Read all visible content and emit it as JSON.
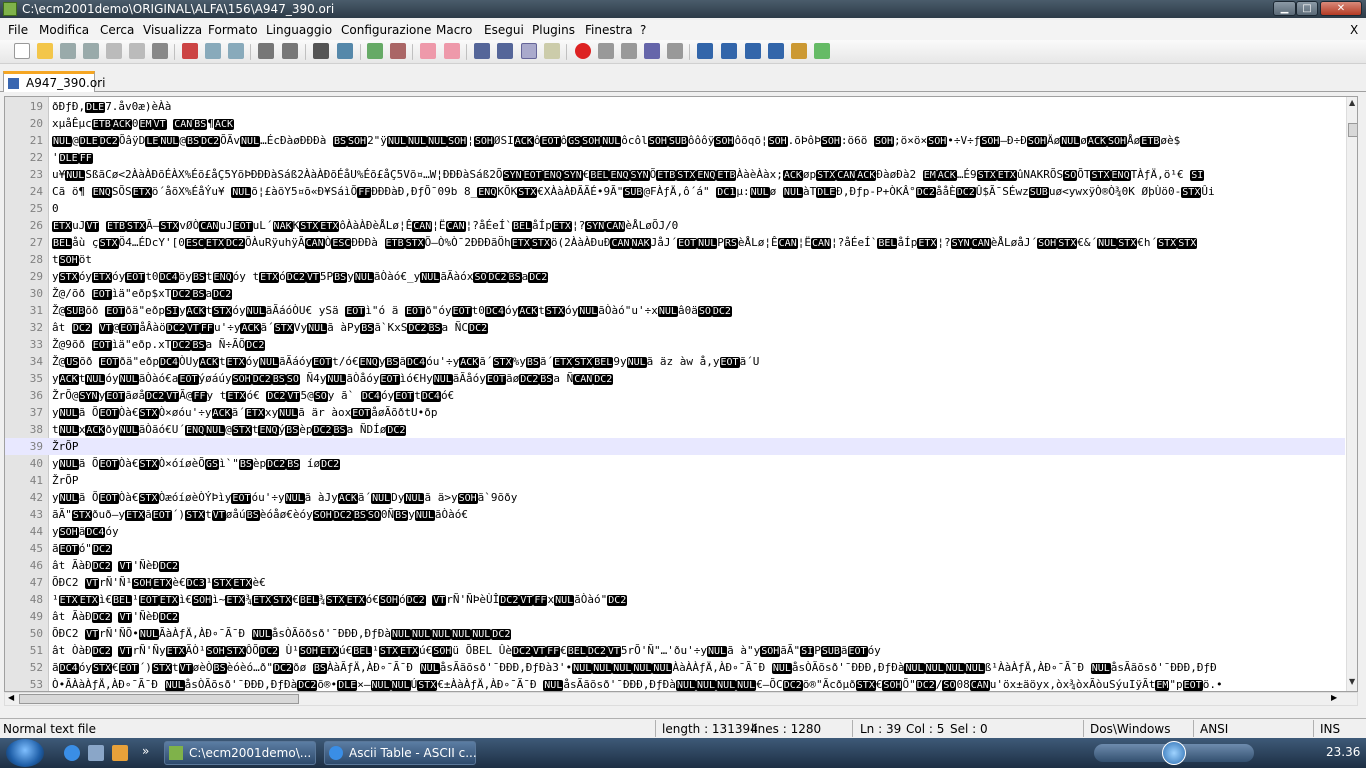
{
  "window": {
    "title": "C:\\ecm2001demo\\ORIGINAL\\ALFA\\156\\A947_390.ori",
    "minimize_icon": "minimize-icon",
    "maximize_icon": "maximize-icon",
    "close_icon": "close-icon"
  },
  "menu": {
    "items": [
      "File",
      "Modifica",
      "Cerca",
      "Visualizza",
      "Formato",
      "Linguaggio",
      "Configurazione",
      "Macro",
      "Esegui",
      "Plugins",
      "Finestra",
      "?"
    ],
    "close_label": "X"
  },
  "toolbar": {
    "buttons": [
      "new-icon",
      "open-icon",
      "save-icon",
      "save-all-icon",
      "close-icon",
      "close-all-icon",
      "print-icon",
      "cut-icon",
      "copy-icon",
      "paste-icon",
      "undo-icon",
      "redo-icon",
      "find-icon",
      "replace-icon",
      "zoom-in-icon",
      "zoom-out-icon",
      "sync-v-icon",
      "sync-h-icon",
      "word-wrap-icon",
      "show-all-chars-icon",
      "indent-guide-icon",
      "doc-map-icon",
      "record-macro-icon",
      "stop-record-icon",
      "play-macro-icon",
      "run-macro-multiple-icon",
      "save-macro-icon",
      "first-icon",
      "up-icon",
      "down-icon",
      "last-icon",
      "launch-icon",
      "spellcheck-icon"
    ]
  },
  "tabs": [
    {
      "label": "A947_390.ori",
      "icon": "document-icon"
    }
  ],
  "editor": {
    "current_line": 39,
    "lines": [
      {
        "n": "19",
        "t": "ðÐƒÐ,[DLE]7.åv0æ)èÀà"
      },
      {
        "n": "20",
        "t": "xµåÊµc[ETB][ACK]0[EM][VT] [CAN][BS]¶[ACK]"
      },
      {
        "n": "21",
        "t": "[NUL]@[DLE][DC2]ÕâÿD[LE][NUL]@[BS][DC2]ÕÃv[NUL]…ÉcÐàøÐÐÐà [BS][SOH]2\"ÿ[NUL][NUL][NUL][SOH]¦[SOH]ØSI[ACK]ô[EOT]ô[GS][SOH][NUL]ôcôl[SOH][SUB]ôôôÿ[SOH]ôõqõ¦[SOH].õÞôÞ[SOH]:ö6ö [SOH];ö×ö×[SOH]•÷V÷ƒ[SOH]–Ð÷Ð[SOH]Äø[NUL]ø[ACK][SOH]Åø[ETB]øè$"
      },
      {
        "n": "22",
        "t": "'[DLE][FF]"
      },
      {
        "n": "23",
        "t": "u¥[NUL]SßãCø<2ÀàÀÐõÉÀX%Éõ£åÇ5YõÞÐÐÐàSáß2ÀàÀÐõÉåU%Éõ£åÇ5Võ¤…W¦ÐÐÐàSáß2Õ[SYN][EOT][ENQ][SYN]€[BEL][ENQ][SYN]Õ[ETB][STX][ENQ][ETB]ÀàèÀàx;[ACK]øp[STX][CAN][ACK]ÐàøÐà2 [EM][ACK]…É9[STX][ETX]ûNAKRÕS[SO]ÕT[STX][ENQ]TÀƒÄ,ö¹€ [SI]"
      },
      {
        "n": "24",
        "t": "Cã ö¶ [ENQ]SÕS[ETX]ö´åõX%ÉåÝu¥ [NUL]õ¦£àõY5¤õ«Ð¥SáìÕ[FF]ÐÐÐàÐ,ÐƒÕ¯09b 8_[ENQ]KÕK[STX]€XÀàÀÐÃÃÉ•9Ã\"[SUB]@FÀƒÄ,ô´á\" [DC1]µ:[NUL]ø [NUL]àT[DLE]Ð,Ðƒp-P+ÒKÂ°[DC2]ååÈ[DC2]Û$Ã¯SÉwz[SUB]uø<ywxÿÒ®Ò¾0K  ØþÙö0-[STX]Ûi"
      },
      {
        "n": "25",
        "t": "0"
      },
      {
        "n": "26",
        "t": "[ETX]uJ[VT] [ETB][STX]Ã—[STX]vØÒ[CAN]uJ[EOT]uL´[NAK]K[STX][ETX]ôÀàÀÐèÅLø¦Ê[CAN]¦Ë[CAN]¦?åÉeÍ`[BEL]åÍp[ETX]¦?[SYN][CAN]èÅLøÕJ/0"
      },
      {
        "n": "27",
        "t": "[BEL]åù ç[STX]Ö4…ÉDcY'[0[ESC][ETX][DC2]ÕÀuRÿuhÿÃ[CAN]Ò[ESC]ÐÐÐà [ETB][STX]Õ—Ò%Ò¯2ÐÐÐãÖh[ETX][STX]ö(2ÀàÀÐuÐ[CAN][NAK]JåJ´[EOT][NUL]P[RS]èÅLø¦Ê[CAN]¦Ë[CAN]¦?åÉeÍ`[BEL]åÍp[ETX]¦?[SYN][CAN]èÅLøåJ´[SOH][STX]€&´[NUL][STX]€h´[STX][STX]"
      },
      {
        "n": "28",
        "t": "t[SOH]öt"
      },
      {
        "n": "29",
        "t": "y[STX]óy[ETX]óy[EOT]t0[DC4]öy[BS]t[ENQ]óy t[ETX]ó[DC2][VT]5P[BS]y[NUL]ãÒàó€_y[NUL]ãÃàóx[SO][DC2][BS]a[DC2]"
      },
      {
        "n": "30",
        "t": "Ž@/õð [EOT]ìä\"eðp$xT[DC2][BS]a[DC2]"
      },
      {
        "n": "31",
        "t": "Ž@[SUB]õð [EOT]ðä\"eðp[SI]y[ACK]t[STX]óy[NUL]ãÃáóÒU€ ySä [EOT]ì\"ó  ä [EOT]ð\"óy[EOT]t0[DC4]óy[ACK]t[STX]óy[NUL]ãÒàó\"u'÷x[NUL]â0ä[SO][DC2]"
      },
      {
        "n": "32",
        "t": "ât [DC2] [VT]@[EOT]åÂàö[DC2][VT][FF]u'÷y[ACK]ã´[STX]Vy[NUL]ã àPy[BS]ã`KxS[DC2][BS]a ÑC[DC2]"
      },
      {
        "n": "33",
        "t": "Ž@9õð [EOT]ìä\"eðp.xT[DC2][BS]a Ñ÷ÃÕ[DC2]"
      },
      {
        "n": "34",
        "t": "Ž@[US]õð [EOT]ðä\"eðp[DC4]ÒUy[ACK]t[ETX]óy[NUL]ãÃáóy[EOT]t/ó€[ENQ]y[BS]ã[DC4]óu'÷y[ACK]ã´[STX]%y[BS]ã´[ETX][STX][BEL]9y[NUL]ã äz àw å,y[EOT]ã´U"
      },
      {
        "n": "35",
        "t": "y[ACK]t[NUL]óy[NUL]ãÒàó€a[EOT]ýøáúy[SOH][DC2][BS][SO] Ñ4y[NUL]ãÒåóy[EOT]ìó€Hy[NUL]ãÃåóy[EOT]ãø[DC2][BS]a Ñ[CAN][DC2]"
      },
      {
        "n": "36",
        "t": "ŽrÕ@[SYN]y[EOT]ãøå[DC2][VT]Ã@[FF]y t[ETX]ó€ [DC2][VT]5@[SO]y ã`  [DC4]óy[EOT]t[DC4]ó€"
      },
      {
        "n": "37",
        "t": "y[NUL]ã Õ[EOT]Òà€[STX]Ò×øóu'÷y[ACK]ã´[ETX]xy[NUL]ã är àox[EOT]åøÃõðtU•ðp"
      },
      {
        "n": "38",
        "t": "t[NUL]x[ACK]ðy[NUL]ãÒãó€U´[ENQ][NUL]@[STX]t[ENQ]ý[BS]èp[DC2][BS]a ÑDÍø[DC2]"
      },
      {
        "n": "39",
        "t": "ŽrÕP"
      },
      {
        "n": "40",
        "t": "y[NUL]ã Õ[EOT]Òà€[STX]Ò×óíøèÕ[GS]ì`\"[BS]èp[DC2][BS] íø[DC2]"
      },
      {
        "n": "41",
        "t": "ŽrÕP"
      },
      {
        "n": "42",
        "t": "y[NUL]ã Õ[EOT]Òà€[STX]ÒæóíøèÒÝÞìy[EOT]óu'÷y[NUL]ã àJy[ACK]ã´[NUL]Dy[NUL]ã ä>y[SOH]ã`9õðy"
      },
      {
        "n": "43",
        "t": "ãÃ\"[STX]ðuð–y[ETX]ã[EOT]´)[STX]t[VT]øåú[BS]èóåø€èóy[SOH][DC2][BS][SO]0Ñ[BS]y[NUL]ãÒàó€"
      },
      {
        "n": "44",
        "t": "y[SOH]ã[DC4]óy"
      },
      {
        "n": "45",
        "t": "ã[EOT]ó\"[DC2]"
      },
      {
        "n": "46",
        "t": "ât ÃàÐ[DC2]  [VT]'ÑèÐ[DC2]"
      },
      {
        "n": "47",
        "t": "ÕÐC2  [VT]rÑ'Ñ¹[SOH][ETX]è€[DC3]¹[STX][ETX]è€"
      },
      {
        "n": "48",
        "t": "¹[ETX][ETX]ì€[BEL]¹[EOT][ETX]ì€[SOH]ì~[ETX]¾[ETX][STX]€[BEL]¾[STX][ETX]ó€[SOH]ó[DC2]  [VT]rÑ'ÑÞèÙÎ[DC2][VT][FF]x[NUL]ãÒàó\"[DC2]"
      },
      {
        "n": "49",
        "t": "ât ÃàÐ[DC2]  [VT]'ÑèÐ[DC2]"
      },
      {
        "n": "50",
        "t": "ÕÐC2  [VT]rÑ'ÑÕ•[NUL]ÃàÀƒÄ,ÀÐ∘¯Ã¯Ð [NUL]åsÒÃõðsð'¯ÐÐÐ,ÐƒÐà[NUL][NUL][NUL][NUL][NUL][DC2]"
      },
      {
        "n": "51",
        "t": "ât ÒàÐ[DC2]  [VT]rÑ'Ñy[ETX]ÃÒ¹[SOH][STX]ÔÕ[DC2] Ù¹[SOH][ETX]ú€[BEL]¹[STX][ETX]ú€[SOH]ü ÕBEL Ûè[DC2][VT][FF]€[BEL][DC2][VT]5rÕ'Ñ\"…'ðu'÷y[NUL]ã à\"y[SOH]ãÃ\"[SI]P[SUB]ã[EOT]óy"
      },
      {
        "n": "52",
        "t": "ã[DC4]óy[STX]€[EOT]´)[STX]t[VT]øèÒ[BS]èóèó…ð\"[DC2]ðø [BS]ÀàÃƒÄ,ÀÐ∘¯Ã¯Ð [NUL]åsÃãõsð'¯ÐÐÐ,ÐƒÐà3'•[NUL][NUL][NUL][NUL][NUL]ÀàÀÀƒÄ,ÀÐ∘¯Ã¯Ð [NUL]åsÒÃõsð'¯ÐÐÐ,ÐƒÐà[NUL][NUL][NUL][NUL]ß¹ÀàÀƒÄ,ÀÐ∘¯Ã¯Ð [NUL]åsÃãõsð'¯ÐÐÐ,ÐƒÐ"
      },
      {
        "n": "53",
        "t": "Ò•ÃÀàÀƒÄ,ÀÐ∘¯Ã¯Ð [NUL]åsÒÃõsð'¯ÐÐÐ,ÐƒÐà[DC2]õ®•[DLE]×–[NUL][NUL]Ú[STX]€±ÀàÀƒÄ,ÀÐ∘¯Ã¯Ð [NUL]åsÃãõsð'¯ÐÐÐ,ÐƒÐà[NUL][NUL][NUL][NUL]€–ÕC[DC2]õ®\"Ãcðµð[STX]€[SOH]Õ\"[DC2]/[SO]08[CAN]u'öx±äöyx,òx¾òxÃòuSýuIÿÃt[EM]\"p[EOT]ö.•"
      }
    ]
  },
  "status": {
    "file_type": "Normal text file",
    "length": "length : 131394",
    "lines": "lines : 1280",
    "ln": "Ln : 39",
    "col": "Col : 5",
    "sel": "Sel : 0",
    "eol": "Dos\\Windows",
    "encoding": "ANSI",
    "mode": "INS"
  },
  "taskbar": {
    "items": [
      {
        "label": "C:\\ecm2001demo\\...",
        "icon": "notepadpp-icon"
      },
      {
        "label": "Ascii Table - ASCII c...",
        "icon": "internet-explorer-icon"
      }
    ],
    "clock": "23.36",
    "quicklaunch": [
      "internet-explorer-icon",
      "desktop-icon",
      "media-icon"
    ]
  },
  "colors": {
    "titlebar": "#2c3a47",
    "current_line": "#e8e8ff",
    "control_char_bg": "#000000",
    "tab_accent": "#f5a623"
  }
}
